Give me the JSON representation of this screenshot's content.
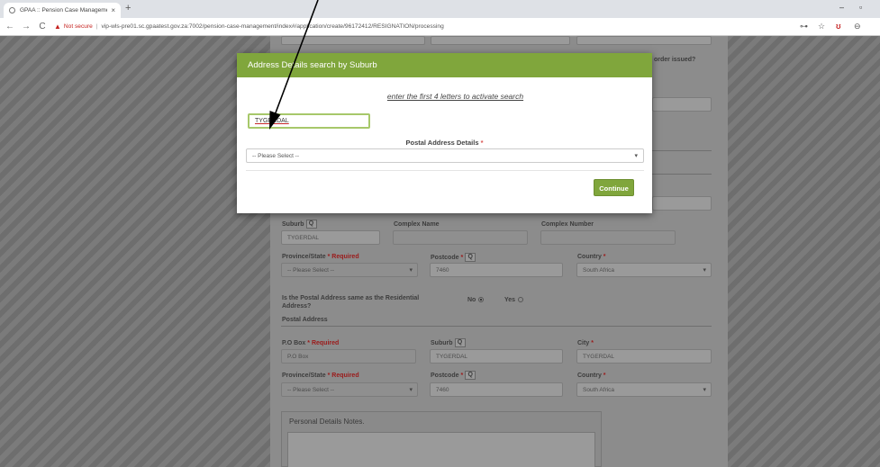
{
  "browser": {
    "tab_title": "GPAA :: Pension Case Manageme",
    "tab_close": "×",
    "new_tab": "+",
    "not_secure": "Not secure",
    "url": "vip-wls-pre01.sc.gpaatest.gov.za:7002/pension-case-management/index#/application/create/96172412/RESIGNATION/processing",
    "window_controls": [
      "–",
      "▫"
    ]
  },
  "modal": {
    "title": "Address Details search by Suburb",
    "hint": "enter the first 4 letters to activate search",
    "suburb_value": "TYGERDAL",
    "postal_label": "Postal Address Details",
    "postal_required": "*",
    "postal_placeholder": "-- Please Select --",
    "continue_label": "Continue"
  },
  "background_form": {
    "order_issued": "order issued?",
    "suburb_label": "Suburb",
    "suburb_value": "TYGERDAL",
    "complex_name_label": "Complex Name",
    "complex_number_label": "Complex Number",
    "province_label": "Province/State",
    "required_text": "* Required",
    "star": "*",
    "please_select": "-- Please Select --",
    "postcode_label": "Postcode",
    "postcode_value": "7460",
    "country_label": "Country",
    "country_value": "South Africa",
    "same_address_question": "Is the Postal Address same as the Residential Address?",
    "no_label": "No",
    "yes_label": "Yes",
    "postal_address_heading": "Postal Address",
    "po_box_label": "P.O Box",
    "po_box_placeholder": "P.O Box",
    "city_label": "City",
    "city_value": "TYGERDAL",
    "notes_heading": "Personal Details Notes."
  }
}
